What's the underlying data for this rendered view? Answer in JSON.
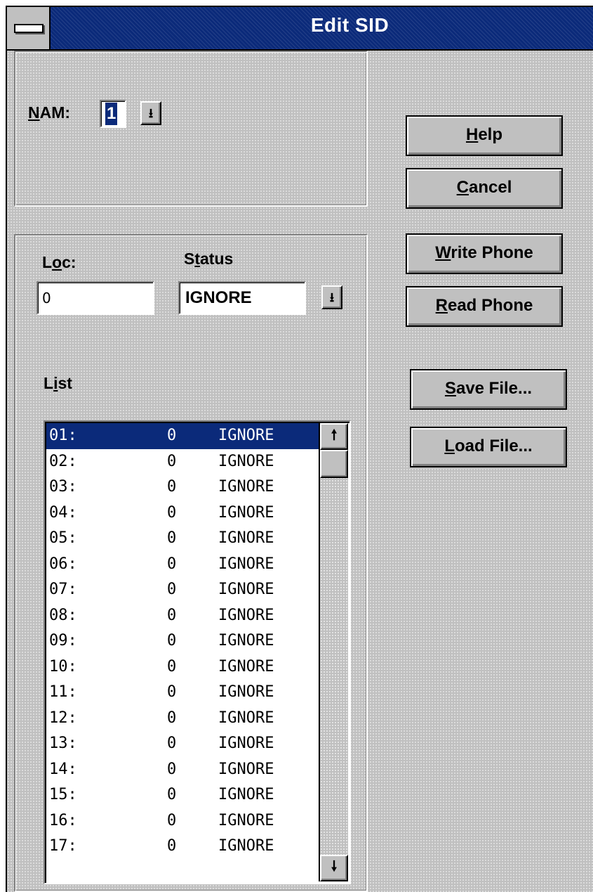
{
  "window": {
    "title": "Edit SID",
    "sysmenu_icon": "system-menu-icon"
  },
  "nam": {
    "label_accel": "N",
    "label_rest": "AM:",
    "value": "1",
    "dropdown_icon": "down-arrow-icon"
  },
  "loc": {
    "label_pre": "L",
    "label_accel": "o",
    "label_rest": "c:",
    "value": "0"
  },
  "status": {
    "label_pre": "S",
    "label_accel": "t",
    "label_rest": "atus",
    "value": "IGNORE",
    "dropdown_icon": "down-arrow-icon"
  },
  "list": {
    "label_pre": "L",
    "label_accel": "i",
    "label_rest": "st",
    "selected_index": 0,
    "rows": [
      {
        "id": "01:",
        "loc": "0",
        "status": "IGNORE"
      },
      {
        "id": "02:",
        "loc": "0",
        "status": "IGNORE"
      },
      {
        "id": "03:",
        "loc": "0",
        "status": "IGNORE"
      },
      {
        "id": "04:",
        "loc": "0",
        "status": "IGNORE"
      },
      {
        "id": "05:",
        "loc": "0",
        "status": "IGNORE"
      },
      {
        "id": "06:",
        "loc": "0",
        "status": "IGNORE"
      },
      {
        "id": "07:",
        "loc": "0",
        "status": "IGNORE"
      },
      {
        "id": "08:",
        "loc": "0",
        "status": "IGNORE"
      },
      {
        "id": "09:",
        "loc": "0",
        "status": "IGNORE"
      },
      {
        "id": "10:",
        "loc": "0",
        "status": "IGNORE"
      },
      {
        "id": "11:",
        "loc": "0",
        "status": "IGNORE"
      },
      {
        "id": "12:",
        "loc": "0",
        "status": "IGNORE"
      },
      {
        "id": "13:",
        "loc": "0",
        "status": "IGNORE"
      },
      {
        "id": "14:",
        "loc": "0",
        "status": "IGNORE"
      },
      {
        "id": "15:",
        "loc": "0",
        "status": "IGNORE"
      },
      {
        "id": "16:",
        "loc": "0",
        "status": "IGNORE"
      },
      {
        "id": "17:",
        "loc": "0",
        "status": "IGNORE"
      }
    ],
    "scroll_up_icon": "up-arrow-icon",
    "scroll_down_icon": "down-arrow-icon"
  },
  "buttons": {
    "help": {
      "accel": "H",
      "rest": "elp"
    },
    "cancel": {
      "accel": "C",
      "rest": "ancel"
    },
    "write_phone": {
      "accel": "W",
      "rest": "rite Phone"
    },
    "read_phone": {
      "accel": "R",
      "rest": "ead Phone"
    },
    "save_file": {
      "accel": "S",
      "rest": "ave File..."
    },
    "load_file": {
      "accel": "L",
      "rest": "oad File..."
    }
  },
  "colors": {
    "face": "#c0c0c0",
    "titlebar": "#0b2a7a",
    "selection": "#0b2a7a"
  }
}
